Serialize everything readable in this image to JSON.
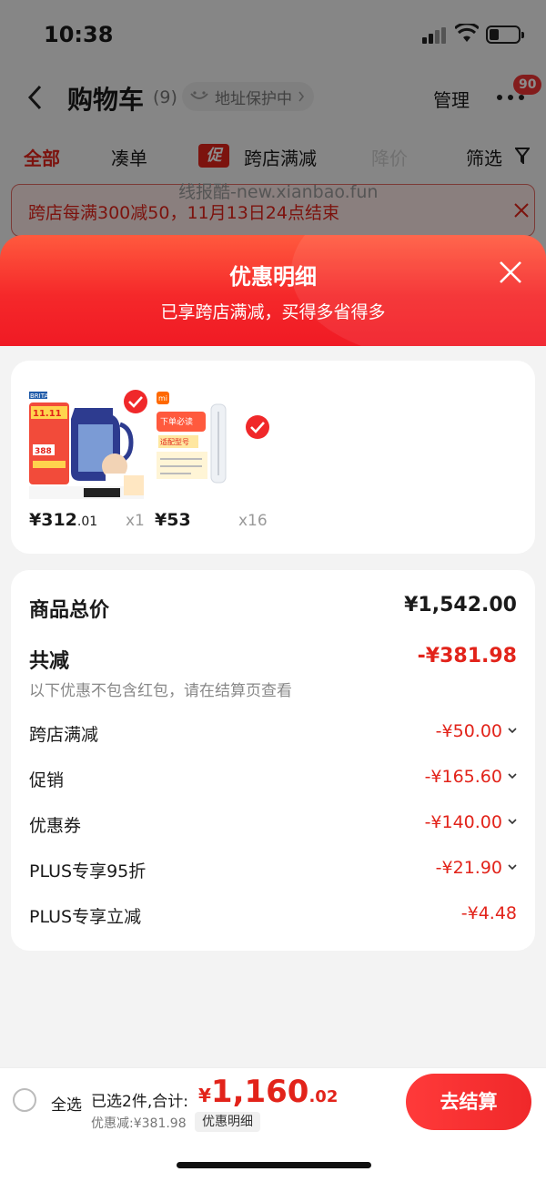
{
  "status_bar": {
    "time": "10:38"
  },
  "nav": {
    "title": "购物车",
    "count": "(9)",
    "address_protect": "地址保护中",
    "manage": "管理",
    "more_badge": "90"
  },
  "tabs": {
    "all": "全部",
    "cou": "凑单",
    "promo_tag": "促",
    "cross": "跨店满减",
    "drop": "降价",
    "filter": "筛选"
  },
  "notice": {
    "text": "跨店每满300减50，11月13日24点结束"
  },
  "watermark": "线报酷-new.xianbao.fun",
  "sheet": {
    "title": "优惠明细",
    "subtitle": "已享跨店满减，买得多省得多"
  },
  "products": [
    {
      "brand": "BRITA",
      "price_int": "¥312",
      "price_dec": ".01",
      "qty": "x1",
      "banner": "11.11",
      "tag": "388"
    },
    {
      "brand": "mi",
      "price_int": "¥53",
      "price_dec": "",
      "qty": "x16",
      "banner": "下单必读",
      "tag": "适配型号"
    }
  ],
  "summary": {
    "goods_total_label": "商品总价",
    "goods_total_value": "¥1,542.00",
    "reduce_label": "共减",
    "reduce_value": "-¥381.98",
    "reduce_note": "以下优惠不包含红包，请在结算页查看",
    "items": [
      {
        "label": "跨店满减",
        "value": "-¥50.00",
        "expandable": true
      },
      {
        "label": "促销",
        "value": "-¥165.60",
        "expandable": true
      },
      {
        "label": "优惠券",
        "value": "-¥140.00",
        "expandable": true
      },
      {
        "label": "PLUS专享95折",
        "value": "-¥21.90",
        "expandable": true
      },
      {
        "label": "PLUS专享立减",
        "value": "-¥4.48",
        "expandable": false
      }
    ]
  },
  "bottom": {
    "select_all": "全选",
    "selected_count": "已选2件,合计:",
    "total_currency": "¥",
    "total_int": "1,160",
    "total_dec": ".02",
    "discount_line": "优惠减:¥381.98",
    "detail_pill": "优惠明细",
    "checkout": "去结算"
  },
  "colors": {
    "accent": "#e2231a",
    "checkout_start": "#ff3a3a",
    "checkout_end": "#f0282a"
  }
}
